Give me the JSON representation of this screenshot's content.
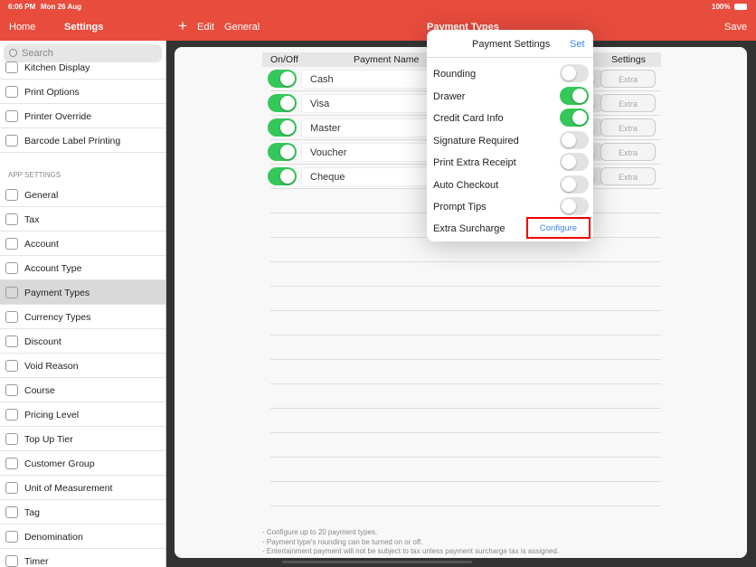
{
  "status": {
    "time": "6:06 PM",
    "date": "Mon 26 Aug",
    "battery": "100%"
  },
  "nav": {
    "home": "Home",
    "settings": "Settings",
    "add": "+",
    "edit": "Edit",
    "general": "General",
    "title": "Payment Types",
    "save": "Save"
  },
  "sidebar": {
    "search_placeholder": "Search",
    "section": "APP SETTINGS",
    "items_top": [
      "Kitchen Display",
      "Print Options",
      "Printer Override",
      "Barcode Label Printing"
    ],
    "items": [
      "General",
      "Tax",
      "Account",
      "Account Type",
      "Payment Types",
      "Currency Types",
      "Discount",
      "Void Reason",
      "Course",
      "Pricing Level",
      "Top Up Tier",
      "Customer Group",
      "Unit of Measurement",
      "Tag",
      "Denomination",
      "Timer"
    ],
    "selected": "Payment Types"
  },
  "table": {
    "headers": {
      "onoff": "On/Off",
      "name": "Payment Name",
      "settings": "Settings"
    },
    "rows": [
      {
        "name": "Cash",
        "on": true,
        "extra": "Extra"
      },
      {
        "name": "Visa",
        "on": true,
        "extra": "Extra"
      },
      {
        "name": "Master",
        "on": true,
        "extra": "Extra"
      },
      {
        "name": "Voucher",
        "on": true,
        "extra": "Extra"
      },
      {
        "name": "Cheque",
        "on": true,
        "extra": "Extra"
      }
    ]
  },
  "notes": [
    "- Configure up to 20 payment types.",
    "- Payment type's rounding can be turned on or off.",
    "- Entertainment payment will not be subject to tax unless payment surcharge tax is assigned."
  ],
  "popover": {
    "title": "Payment Settings",
    "set": "Set",
    "options": [
      {
        "label": "Rounding",
        "on": false
      },
      {
        "label": "Drawer",
        "on": true
      },
      {
        "label": "Credit Card Info",
        "on": true
      },
      {
        "label": "Signature Required",
        "on": false
      },
      {
        "label": "Print Extra Receipt",
        "on": false
      },
      {
        "label": "Auto Checkout",
        "on": false
      },
      {
        "label": "Prompt Tips",
        "on": false
      }
    ],
    "surcharge_label": "Extra Surcharge",
    "configure": "Configure"
  },
  "colors": {
    "brand": "#e84c3d",
    "toggle_on": "#34c759",
    "link": "#3b82f6",
    "highlight": "#ee0000"
  }
}
